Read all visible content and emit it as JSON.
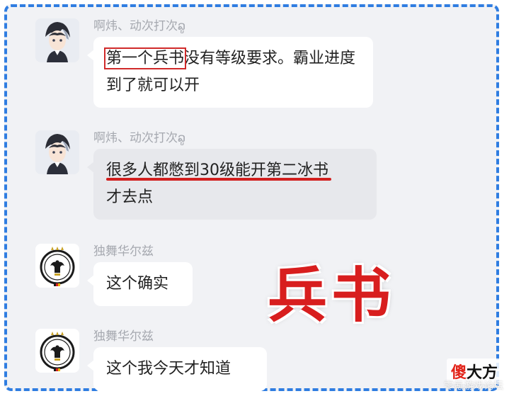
{
  "messages": [
    {
      "sender": "啊炜、动次打次ລູ",
      "avatar_icon": "anime-character-avatar-icon",
      "bubble_style": "white",
      "segments": [
        {
          "text": "第一个兵书",
          "style": "boxed"
        },
        {
          "text": "没有等级要求。霸业进度到了就可以开",
          "style": "plain"
        }
      ]
    },
    {
      "sender": "啊炜、动次打次ລູ",
      "avatar_icon": "anime-character-avatar-icon",
      "bubble_style": "grey",
      "segments": [
        {
          "text": "很多人都憋到30级能开第二冰书",
          "style": "underlined"
        },
        {
          "text": "才去点",
          "style": "plain"
        }
      ]
    },
    {
      "sender": "独舞华尔兹",
      "avatar_icon": "eagle-crest-avatar-icon",
      "bubble_style": "white",
      "segments": [
        {
          "text": "这个确实",
          "style": "plain"
        }
      ]
    },
    {
      "sender": "独舞华尔兹",
      "avatar_icon": "eagle-crest-avatar-icon",
      "bubble_style": "white",
      "segments": [
        {
          "text": "这个我今天才知道",
          "style": "plain"
        }
      ]
    }
  ],
  "overlay_title": "兵书",
  "watermark": {
    "logo_part1": "傻",
    "logo_part2": "大方",
    "text": "零氪游戏论坛"
  },
  "colors": {
    "frame_border": "#2f7de1",
    "highlight_red": "#d21f1f",
    "chat_background": "#f1f2f5"
  }
}
